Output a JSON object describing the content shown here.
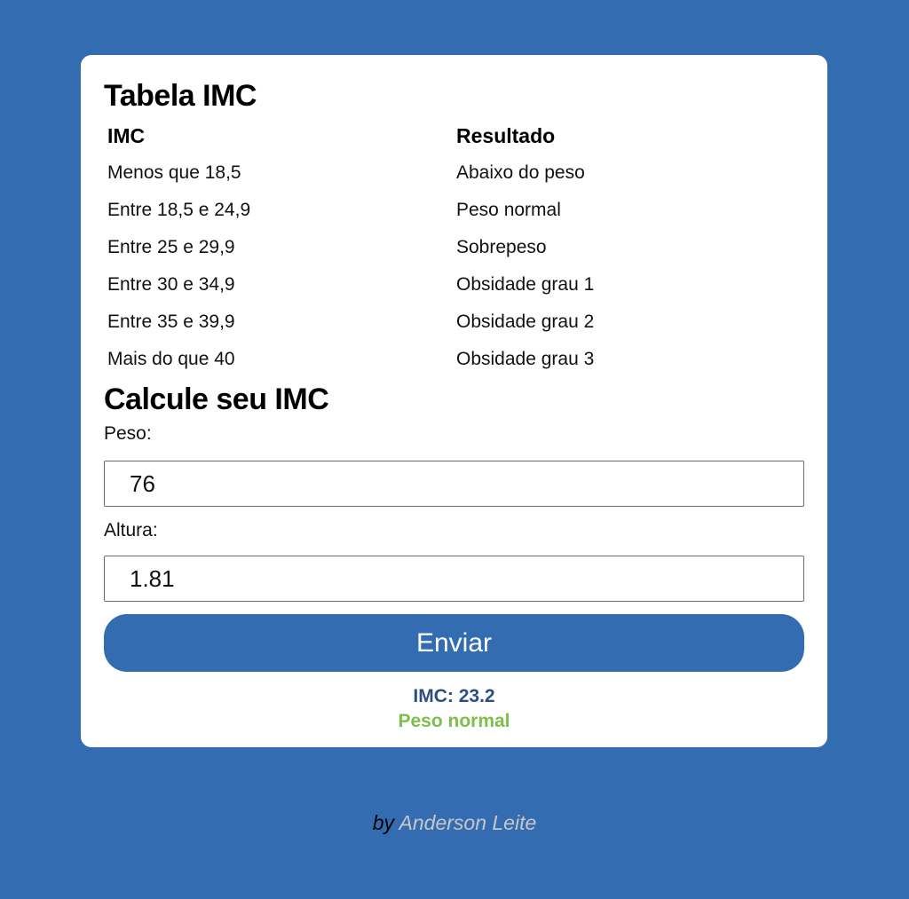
{
  "table_section": {
    "title": "Tabela IMC",
    "headers": [
      "IMC",
      "Resultado"
    ],
    "rows": [
      [
        "Menos que 18,5",
        "Abaixo do peso"
      ],
      [
        "Entre 18,5 e 24,9",
        "Peso normal"
      ],
      [
        "Entre 25 e 29,9",
        "Sobrepeso"
      ],
      [
        "Entre 30 e 34,9",
        "Obsidade grau 1"
      ],
      [
        "Entre 35 e 39,9",
        "Obsidade grau 2"
      ],
      [
        "Mais do que 40",
        "Obsidade grau 3"
      ]
    ]
  },
  "form": {
    "title": "Calcule seu IMC",
    "peso_label": "Peso:",
    "peso_value": "76",
    "altura_label": "Altura:",
    "altura_value": "1.81",
    "submit_label": "Enviar"
  },
  "result": {
    "imc_text": "IMC: 23.2",
    "classification": "Peso normal"
  },
  "footer": {
    "by": "by",
    "author": "Anderson Leite"
  },
  "colors": {
    "background": "#336cb1",
    "button": "#336cb1",
    "imc_value": "#2b4f80",
    "classification": "#7cc04b",
    "author_link": "#c7c7c7"
  }
}
